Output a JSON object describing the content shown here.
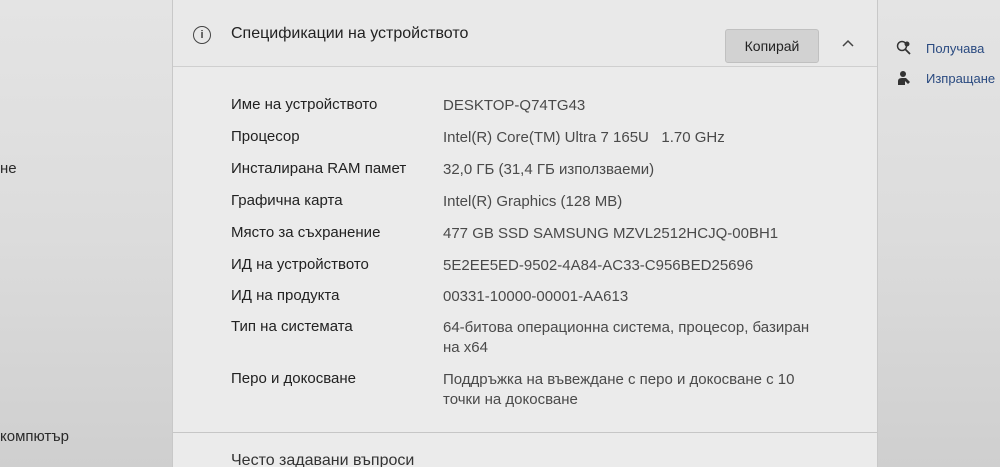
{
  "left_panel": {
    "text_1": "не",
    "text_2": "компютър"
  },
  "card": {
    "title": "Спецификации на устройството",
    "copy_label": "Копирай",
    "specs": [
      {
        "label": "Име на устройството",
        "value": "DESKTOP-Q74TG43"
      },
      {
        "label": "Процесор",
        "value": "Intel(R) Core(TM) Ultra 7 165U   1.70 GHz"
      },
      {
        "label": "Инсталирана RAM памет",
        "value": "32,0 ГБ (31,4 ГБ използваеми)"
      },
      {
        "label": "Графична карта",
        "value": "Intel(R) Graphics (128 MB)"
      },
      {
        "label": "Място за съхранение",
        "value": "477 GB SSD SAMSUNG MZVL2512HCJQ-00BH1"
      },
      {
        "label": "ИД на устройството",
        "value": "5E2EE5ED-9502-4A84-AC33-C956BED25696"
      },
      {
        "label": "ИД на продукта",
        "value": "00331-10000-00001-AA613"
      },
      {
        "label": "Тип на системата",
        "value": "64-битова операционна система, процесор, базиран на x64"
      },
      {
        "label": "Перо и докосване",
        "value": "Поддръжка на въвеждане с перо и докосване с 10 точки на докосване"
      }
    ],
    "faq_title": "Често задавани въпроси"
  },
  "right_panel": {
    "link_1": "Получава",
    "link_2": "Изпращане"
  }
}
